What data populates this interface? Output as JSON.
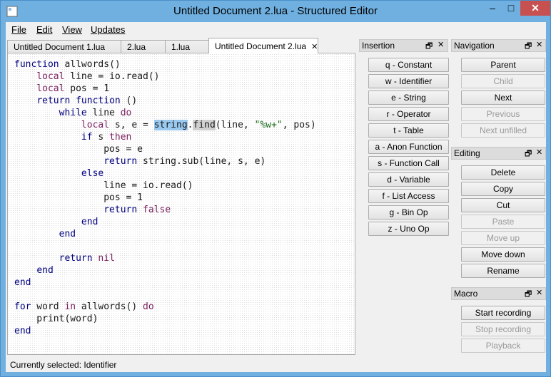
{
  "window": {
    "title": "Untitled Document 2.lua - Structured Editor"
  },
  "menu": [
    "File",
    "Edit",
    "View",
    "Updates"
  ],
  "tabs": [
    {
      "label": "Untitled Document 1.lua",
      "active": false
    },
    {
      "label": "2.lua",
      "active": false
    },
    {
      "label": "1.lua",
      "active": false
    },
    {
      "label": "Untitled Document 2.lua",
      "active": true,
      "close": "✕"
    }
  ],
  "code": {
    "lines": [
      "function allwords()",
      "    local line = io.read()",
      "    local pos = 1",
      "    return function ()",
      "        while line do",
      "            local s, e = string.find(line, \"%w+\", pos)",
      "            if s then",
      "                pos = e",
      "                return string.sub(line, s, e)",
      "            else",
      "                line = io.read()",
      "                pos = 1",
      "                return false",
      "            end",
      "        end",
      "",
      "        return nil",
      "    end",
      "end",
      "",
      "for word in allwords() do",
      "    print(word)",
      "end"
    ]
  },
  "status": "Currently selected: Identifier",
  "panels": {
    "insertion": {
      "title": "Insertion",
      "buttons": [
        "q - Constant",
        "w - Identifier",
        "e - String",
        "r - Operator",
        "t - Table",
        "a - Anon Function",
        "s - Function Call",
        "d - Variable",
        "f - List Access",
        "g - Bin Op",
        "z - Uno Op"
      ]
    },
    "navigation": {
      "title": "Navigation",
      "buttons": [
        {
          "label": "Parent",
          "enabled": true
        },
        {
          "label": "Child",
          "enabled": false
        },
        {
          "label": "Next",
          "enabled": true
        },
        {
          "label": "Previous",
          "enabled": false
        },
        {
          "label": "Next unfilled",
          "enabled": false
        }
      ]
    },
    "editing": {
      "title": "Editing",
      "buttons": [
        {
          "label": "Delete",
          "enabled": true
        },
        {
          "label": "Copy",
          "enabled": true
        },
        {
          "label": "Cut",
          "enabled": true
        },
        {
          "label": "Paste",
          "enabled": false
        },
        {
          "label": "Move up",
          "enabled": false
        },
        {
          "label": "Move down",
          "enabled": true
        },
        {
          "label": "Rename",
          "enabled": true
        }
      ]
    },
    "macro": {
      "title": "Macro",
      "buttons": [
        {
          "label": "Start recording",
          "enabled": true
        },
        {
          "label": "Stop recording",
          "enabled": false
        },
        {
          "label": "Playback",
          "enabled": false
        }
      ]
    }
  },
  "icons": {
    "window_minimize": "–",
    "window_maximize": "□",
    "window_close": "✕",
    "panel_float": "🗗",
    "panel_close": "✕"
  }
}
